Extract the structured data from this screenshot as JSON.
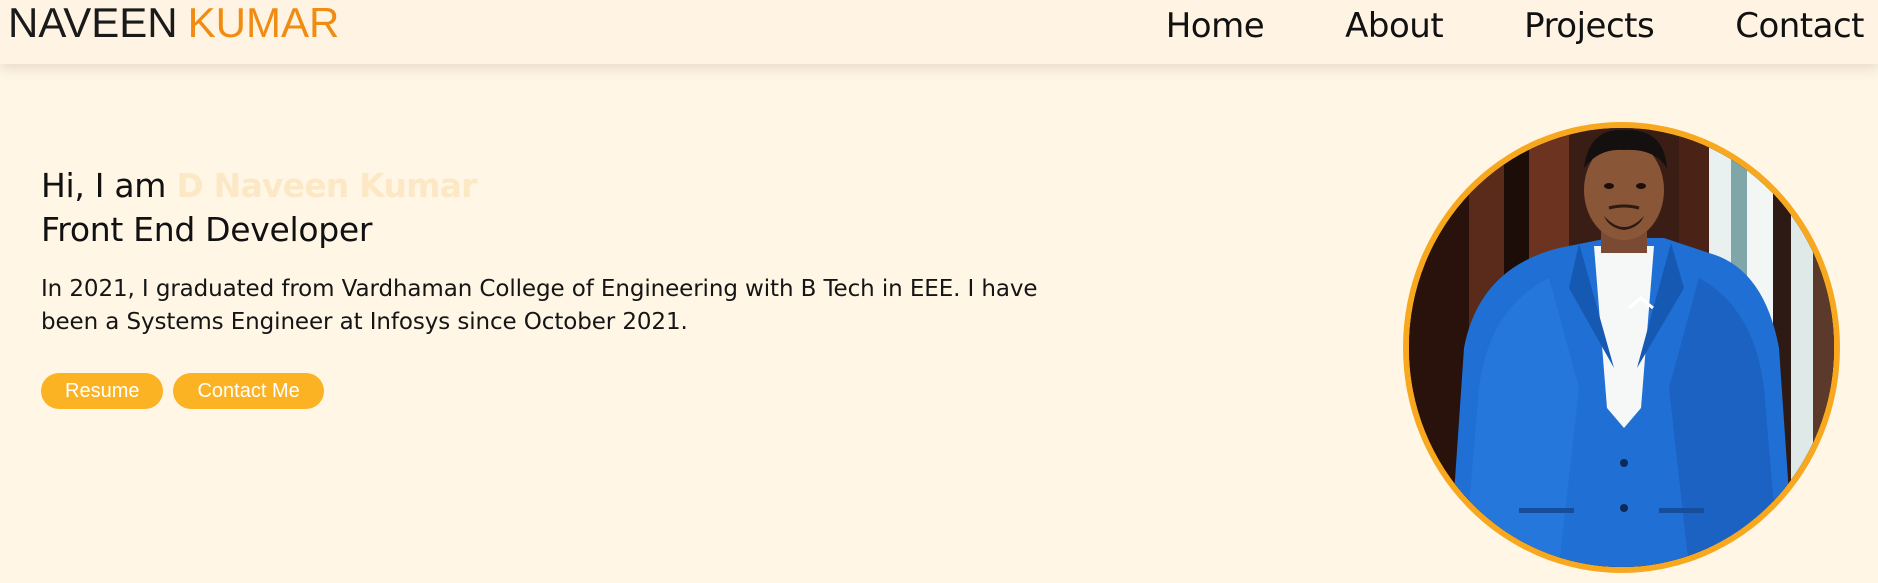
{
  "header": {
    "logo_first": "NAVEEN",
    "logo_second": "KUMAR",
    "nav": [
      {
        "label": "Home"
      },
      {
        "label": "About"
      },
      {
        "label": "Projects"
      },
      {
        "label": "Contact"
      }
    ]
  },
  "hero": {
    "greeting": "Hi, I am",
    "name": "D Naveen Kumar",
    "role": "Front End Developer",
    "bio": "In 2021, I graduated from Vardhaman College of Engineering with B Tech in EEE. I have been a Systems Engineer at Infosys since October 2021.",
    "buttons": {
      "resume": "Resume",
      "contact": "Contact Me"
    }
  },
  "colors": {
    "page_background": "#fff6e6",
    "accent_orange": "#f08c12",
    "button_yellow": "#fbb223",
    "photo_border": "#f8a81e"
  }
}
